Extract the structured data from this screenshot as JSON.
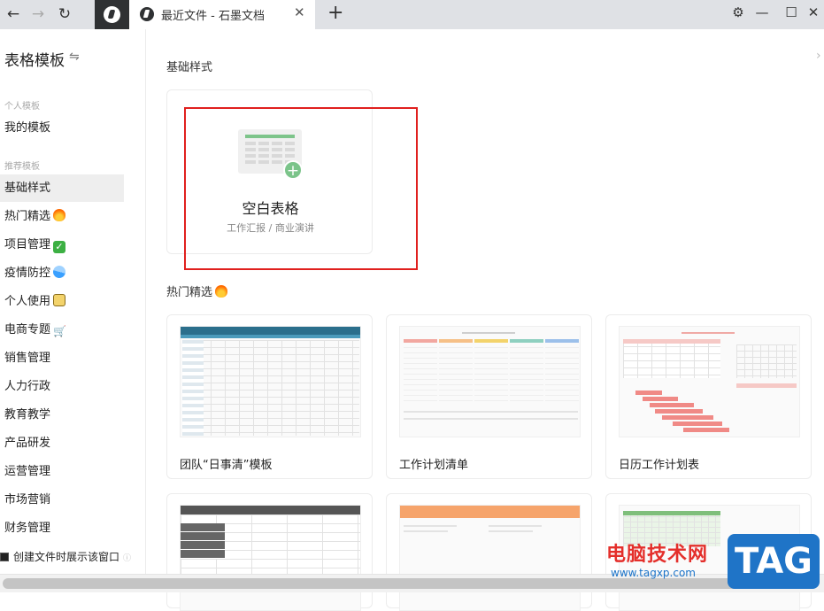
{
  "topbar": {
    "tab_title": "最近文件 - 石墨文档",
    "icons": {
      "back": "arrow-left-icon",
      "forward": "arrow-right-icon",
      "reload": "reload-icon",
      "settings": "gear-icon"
    }
  },
  "sidebar": {
    "title": "表格模板",
    "groups": {
      "personal": "个人模板",
      "recommended": "推荐模板"
    },
    "items": [
      {
        "label": "我的模板"
      },
      {
        "label": "基础样式",
        "active": true
      },
      {
        "label": "热门精选",
        "emoji": "fire"
      },
      {
        "label": "项目管理",
        "emoji": "check"
      },
      {
        "label": "疫情防控",
        "emoji": "pill"
      },
      {
        "label": "个人使用",
        "emoji": "person"
      },
      {
        "label": "电商专题",
        "emoji": "cart"
      },
      {
        "label": "销售管理"
      },
      {
        "label": "人力行政"
      },
      {
        "label": "教育教学"
      },
      {
        "label": "产品研发"
      },
      {
        "label": "运营管理"
      },
      {
        "label": "市场营销"
      },
      {
        "label": "财务管理"
      }
    ],
    "checkbox_label": "创建文件时展示该窗口"
  },
  "main": {
    "section_basic": "基础样式",
    "blank_card": {
      "name": "空白表格",
      "desc": "工作汇报 / 商业演讲"
    },
    "section_hot": "热门精选",
    "templates": [
      {
        "name": "团队“日事清”模板"
      },
      {
        "name": "工作计划清单"
      },
      {
        "name": "日历工作计划表"
      }
    ]
  },
  "watermark": {
    "text": "电脑技术网",
    "url": "www.tagxp.com",
    "tag": "TAG"
  },
  "colors": {
    "highlight": "#e0201e",
    "accent_green": "#7bc48a",
    "tab_bar": "#dfe1e5"
  }
}
